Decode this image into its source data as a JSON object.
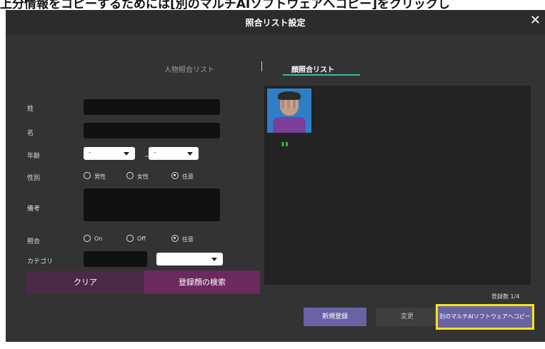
{
  "caption_fragment": "上分情報をコピーするためには[別のマルチAIソフトウェアへコピー]をクリックし",
  "window": {
    "title": "照合リスト設定",
    "close": "✕"
  },
  "tabs": {
    "person_list": "人物照合リスト",
    "face_list": "顔照合リスト"
  },
  "form": {
    "surname_label": "姓",
    "given_name_label": "名",
    "age_label": "年齢",
    "age_from": "-",
    "age_sep": "~",
    "age_to": "-",
    "gender_label": "性別",
    "gender_options": [
      "男性",
      "女性",
      "任意"
    ],
    "gender_selected": "任意",
    "notes_label": "備考",
    "match_label": "照合",
    "match_options": [
      "On",
      "Off",
      "任意"
    ],
    "match_selected": "任意",
    "category_label": "カテゴリ",
    "category_value": ""
  },
  "buttons": {
    "clear": "クリア",
    "search": "登録顔の検索",
    "new": "新規登録",
    "change": "変更",
    "copy": "別のマルチAIソフトウェアへコピー"
  },
  "results": {
    "count_label": "登録数 1/4",
    "thumb_marks": "▮▮"
  },
  "colors": {
    "accent_teal": "#3fb6a5",
    "clear_btn": "#4a2a48",
    "search_btn": "#6b2a5e",
    "action_btn": "#6a63a3",
    "highlight": "#f5e51a"
  }
}
